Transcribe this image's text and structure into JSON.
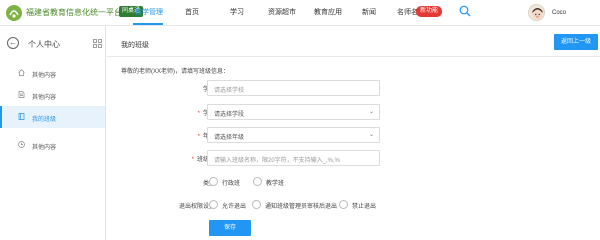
{
  "header": {
    "site_title": "福建省教育信息化统一平台",
    "site_badge": "同桌通",
    "nav": [
      {
        "label": "教学管理",
        "active": true
      },
      {
        "label": "首页"
      },
      {
        "label": "学习"
      },
      {
        "label": "资源超市"
      },
      {
        "label": "教育应用"
      },
      {
        "label": "新闻"
      },
      {
        "label": "名师名校"
      }
    ],
    "new_badge": "新功能",
    "user_name": "Coco",
    "accent_color": "#2196f3"
  },
  "sidebar": {
    "title": "个人中心",
    "items": [
      {
        "label": "其他内容",
        "icon": "home-icon"
      },
      {
        "label": "其他内容",
        "icon": "document-icon"
      },
      {
        "label": "我的班级",
        "icon": "book-icon",
        "active": true
      },
      {
        "label": "其他内容",
        "icon": "clock-icon"
      }
    ]
  },
  "main": {
    "page_title": "我的班级",
    "back_button": "返回上一级",
    "intro": "尊敬的老师(XX老师)，请填写班级信息：",
    "fields": {
      "school": {
        "label": "学校",
        "placeholder": "请选择学校"
      },
      "department": {
        "label": "学段",
        "placeholder": "请选择学段",
        "required": true
      },
      "grade": {
        "label": "年级",
        "placeholder": "请选择年级",
        "required": true
      },
      "class_name": {
        "label": "班级名",
        "placeholder": "请输入班级名称，限20字符，不支持输入_,%,%",
        "required": true
      },
      "type": {
        "label": "类型",
        "options": [
          "行政班",
          "教学班"
        ]
      },
      "exit_permission": {
        "label": "退出权限设置",
        "options": [
          "允许退出",
          "通知班级管理员审核后退出",
          "禁止退出"
        ]
      }
    },
    "save_button": "保存"
  }
}
